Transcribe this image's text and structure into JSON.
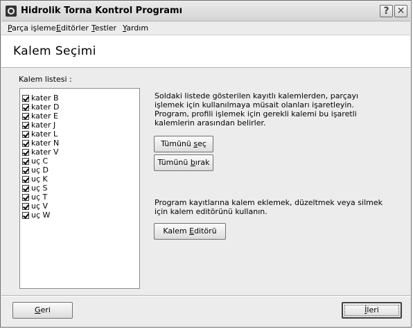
{
  "window": {
    "title": "Hidrolik Torna Kontrol Programı",
    "help_glyph": "?",
    "close_glyph": "✕"
  },
  "menu": {
    "items": [
      {
        "accel": "P",
        "rest": "arça işleme"
      },
      {
        "accel": "E",
        "rest": "ditörler"
      },
      {
        "accel": "T",
        "rest": "estler"
      },
      {
        "accel": "Y",
        "rest": "ardım"
      }
    ]
  },
  "header": {
    "title": "Kalem Seçimi"
  },
  "tool_list": {
    "caption": "Kalem listesi :",
    "items": [
      {
        "label": "kater B",
        "checked": true
      },
      {
        "label": "kater D",
        "checked": true
      },
      {
        "label": "kater E",
        "checked": true
      },
      {
        "label": "kater J",
        "checked": true
      },
      {
        "label": "kater L",
        "checked": true
      },
      {
        "label": "kater N",
        "checked": true
      },
      {
        "label": "kater V",
        "checked": true
      },
      {
        "label": "uç C",
        "checked": true
      },
      {
        "label": "uç D",
        "checked": true
      },
      {
        "label": "uç K",
        "checked": true
      },
      {
        "label": "uç S",
        "checked": true
      },
      {
        "label": "uç T",
        "checked": true
      },
      {
        "label": "uç V",
        "checked": true
      },
      {
        "label": "uç W",
        "checked": true
      }
    ]
  },
  "info": {
    "line1": "Soldaki listede gösterilen kayıtlı kalemlerden, parçayı",
    "line2": "işlemek için kullanılmaya müsait olanları işaretleyin.",
    "line3": "Program, profili işlemek için gerekli kalemi bu işaretli",
    "line4": "kalemlerin arasından belirler.",
    "editor_line1": "Program kayıtlarına kalem eklemek, düzeltmek veya silmek",
    "editor_line2": "için kalem editörünü kullanın."
  },
  "buttons": {
    "select_all": {
      "pre": "Tümünü ",
      "accel": "s",
      "post": "eç"
    },
    "deselect_all": {
      "pre": "Tümünü ",
      "accel": "b",
      "post": "ırak"
    },
    "tool_editor": {
      "pre": "Kalem ",
      "accel": "E",
      "post": "ditörü"
    },
    "back": {
      "pre": "",
      "accel": "G",
      "post": "eri"
    },
    "next": {
      "pre": "",
      "accel": "İ",
      "post": "leri"
    }
  }
}
